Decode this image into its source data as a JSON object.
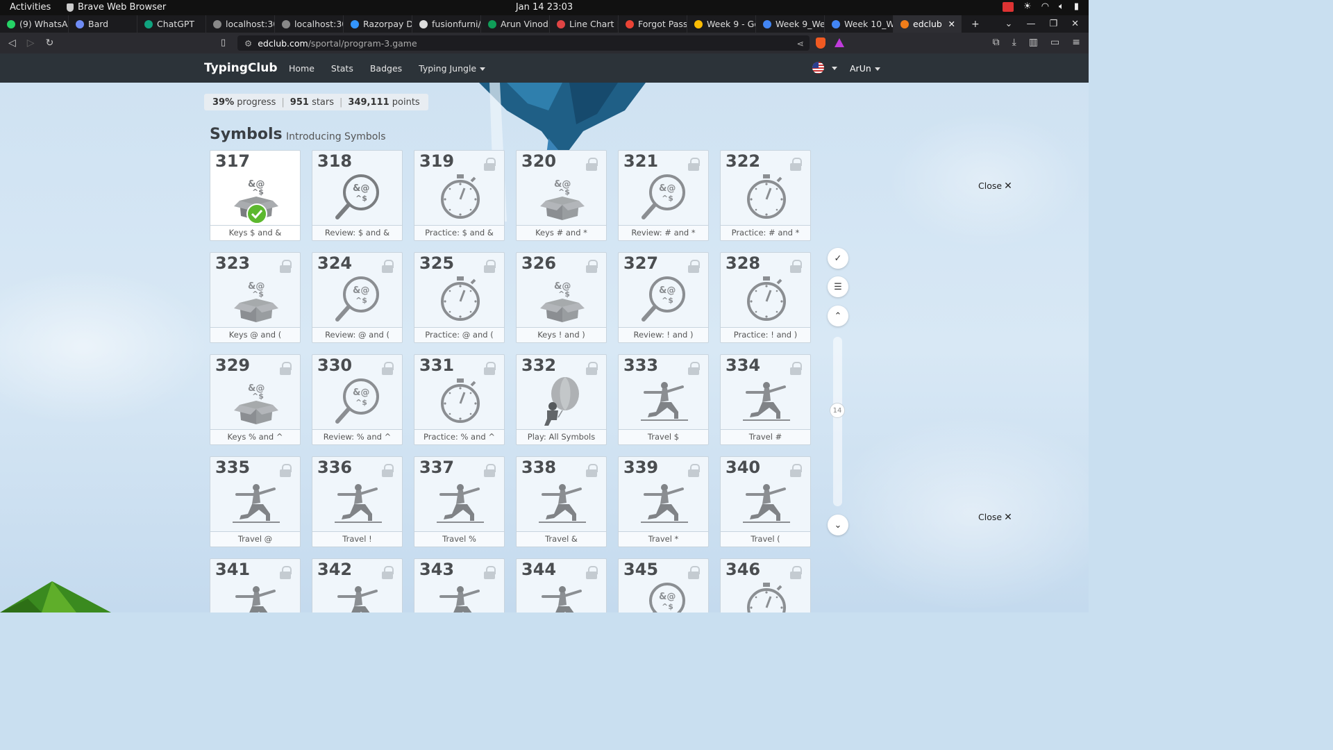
{
  "system": {
    "activities": "Activities",
    "app_name": "Brave Web Browser",
    "clock": "Jan 14  23:03"
  },
  "tabs": [
    {
      "label": "(9) WhatsAp",
      "icon": "whatsapp-icon",
      "color": "#25d366"
    },
    {
      "label": "Bard",
      "icon": "bard-icon",
      "color": "#6f8cf5"
    },
    {
      "label": "ChatGPT",
      "icon": "chatgpt-icon",
      "color": "#10a37f"
    },
    {
      "label": "localhost:30",
      "icon": "globe-icon",
      "color": "#888888"
    },
    {
      "label": "localhost:30",
      "icon": "globe-icon",
      "color": "#888888"
    },
    {
      "label": "Razorpay Da",
      "icon": "razorpay-icon",
      "color": "#3395ff"
    },
    {
      "label": "fusionfurni/",
      "icon": "github-icon",
      "color": "#dddddd"
    },
    {
      "label": "Arun Vinod",
      "icon": "sheets-icon",
      "color": "#0f9d58"
    },
    {
      "label": "Line Chart |",
      "icon": "chart-icon",
      "color": "#e04444"
    },
    {
      "label": "Forgot Pass",
      "icon": "gmail-icon",
      "color": "#ea4335"
    },
    {
      "label": "Week 9 - Go",
      "icon": "drive-icon",
      "color": "#fbbc04"
    },
    {
      "label": "Week 9_We",
      "icon": "docs-icon",
      "color": "#4285f4"
    },
    {
      "label": "Week 10_W",
      "icon": "docs-icon",
      "color": "#4285f4"
    }
  ],
  "active_tab": {
    "label": "edclub",
    "icon": "edclub-icon",
    "color": "#f07d1a"
  },
  "address": {
    "host": "edclub.com",
    "path": "/sportal/program-3.game"
  },
  "site": {
    "brand": "TypingClub",
    "nav": [
      "Home",
      "Stats",
      "Badges",
      "Typing Jungle"
    ],
    "user": "ArUn"
  },
  "stats": {
    "progress_value": "39%",
    "progress_label": "progress",
    "stars_value": "951",
    "stars_label": "stars",
    "points_value": "349,111",
    "points_label": "points"
  },
  "section": {
    "title": "Symbols",
    "subtitle": "Introducing Symbols"
  },
  "lessons": [
    {
      "num": "317",
      "label": "Keys $ and &",
      "icon": "symbol-box-icon",
      "locked": false,
      "done": true
    },
    {
      "num": "318",
      "label": "Review: $ and &",
      "icon": "symbol-magnifier-icon",
      "locked": false,
      "done": false
    },
    {
      "num": "319",
      "label": "Practice: $ and &",
      "icon": "stopwatch-icon",
      "locked": true,
      "done": false
    },
    {
      "num": "320",
      "label": "Keys # and *",
      "icon": "symbol-box-icon",
      "locked": true,
      "done": false
    },
    {
      "num": "321",
      "label": "Review: # and *",
      "icon": "symbol-magnifier-icon",
      "locked": true,
      "done": false
    },
    {
      "num": "322",
      "label": "Practice: # and *",
      "icon": "stopwatch-icon",
      "locked": true,
      "done": false
    },
    {
      "num": "323",
      "label": "Keys @ and (",
      "icon": "symbol-box-icon",
      "locked": true,
      "done": false
    },
    {
      "num": "324",
      "label": "Review: @ and (",
      "icon": "symbol-magnifier-icon",
      "locked": true,
      "done": false
    },
    {
      "num": "325",
      "label": "Practice: @ and (",
      "icon": "stopwatch-icon",
      "locked": true,
      "done": false
    },
    {
      "num": "326",
      "label": "Keys ! and )",
      "icon": "symbol-box-icon",
      "locked": true,
      "done": false
    },
    {
      "num": "327",
      "label": "Review: ! and )",
      "icon": "symbol-magnifier-icon",
      "locked": true,
      "done": false
    },
    {
      "num": "328",
      "label": "Practice: ! and )",
      "icon": "stopwatch-icon",
      "locked": true,
      "done": false
    },
    {
      "num": "329",
      "label": "Keys % and ^",
      "icon": "symbol-box-icon",
      "locked": true,
      "done": false
    },
    {
      "num": "330",
      "label": "Review: % and ^",
      "icon": "symbol-magnifier-icon",
      "locked": true,
      "done": false
    },
    {
      "num": "331",
      "label": "Practice: % and ^",
      "icon": "stopwatch-icon",
      "locked": true,
      "done": false
    },
    {
      "num": "332",
      "label": "Play: All Symbols",
      "icon": "balloon-game-icon",
      "locked": true,
      "done": false
    },
    {
      "num": "333",
      "label": "Travel $",
      "icon": "lunge-figure-icon",
      "locked": true,
      "done": false
    },
    {
      "num": "334",
      "label": "Travel #",
      "icon": "lunge-figure-icon",
      "locked": true,
      "done": false
    },
    {
      "num": "335",
      "label": "Travel @",
      "icon": "lunge-figure-icon",
      "locked": true,
      "done": false
    },
    {
      "num": "336",
      "label": "Travel !",
      "icon": "lunge-figure-icon",
      "locked": true,
      "done": false
    },
    {
      "num": "337",
      "label": "Travel %",
      "icon": "lunge-figure-icon",
      "locked": true,
      "done": false
    },
    {
      "num": "338",
      "label": "Travel &",
      "icon": "lunge-figure-icon",
      "locked": true,
      "done": false
    },
    {
      "num": "339",
      "label": "Travel *",
      "icon": "lunge-figure-icon",
      "locked": true,
      "done": false
    },
    {
      "num": "340",
      "label": "Travel (",
      "icon": "lunge-figure-icon",
      "locked": true,
      "done": false
    },
    {
      "num": "341",
      "label": "",
      "icon": "lunge-figure-icon",
      "locked": true,
      "done": false
    },
    {
      "num": "342",
      "label": "",
      "icon": "lunge-figure-icon",
      "locked": true,
      "done": false
    },
    {
      "num": "343",
      "label": "",
      "icon": "lunge-figure-icon",
      "locked": true,
      "done": false
    },
    {
      "num": "344",
      "label": "",
      "icon": "lunge-figure-icon",
      "locked": true,
      "done": false
    },
    {
      "num": "345",
      "label": "",
      "icon": "symbol-magnifier-icon",
      "locked": true,
      "done": false
    },
    {
      "num": "346",
      "label": "",
      "icon": "stopwatch-icon",
      "locked": true,
      "done": false
    }
  ],
  "close_links": [
    "Close",
    "Close"
  ],
  "scroll_indicator": "14",
  "colors": {
    "navbar": "#2c3339",
    "done_check": "#5cb82e",
    "icon_gray": "#7a7d80"
  }
}
